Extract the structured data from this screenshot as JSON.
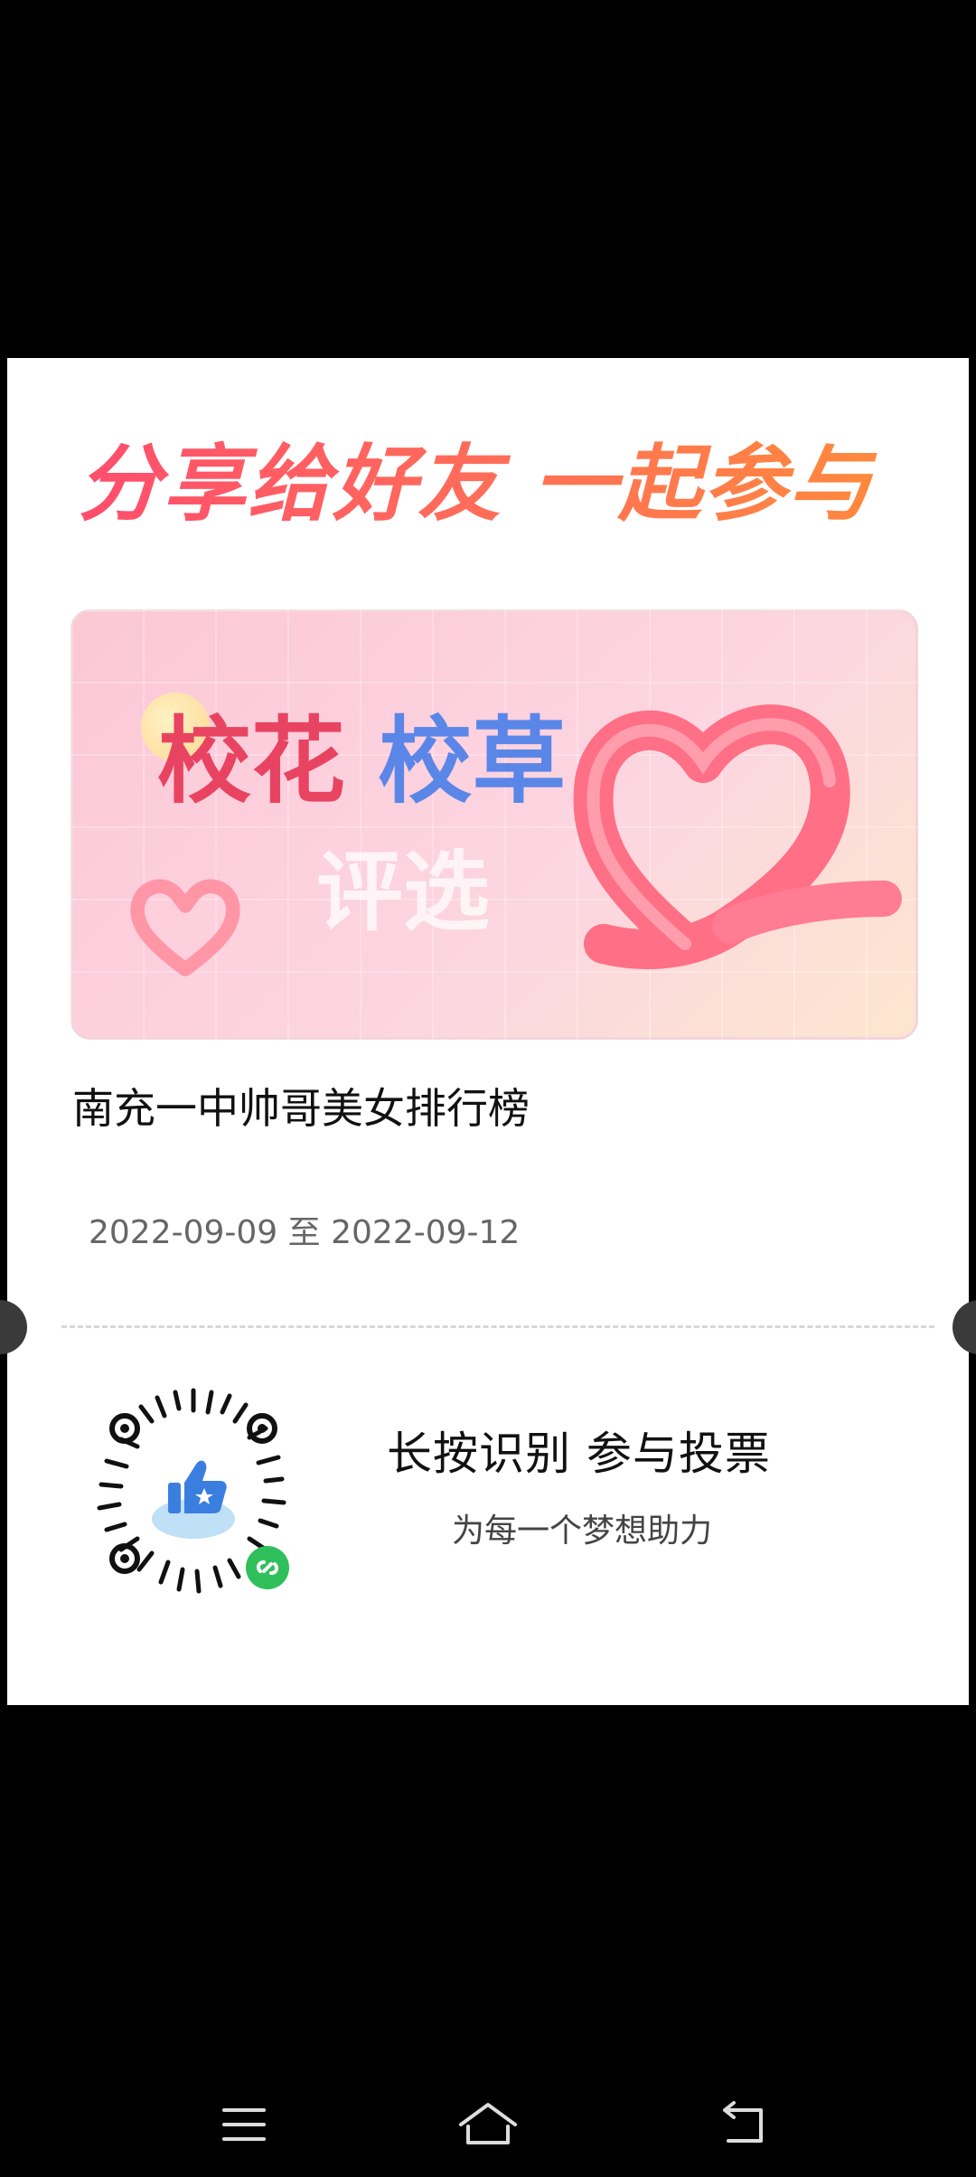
{
  "share": {
    "title": "分享给好友 一起参与"
  },
  "banner": {
    "title_a": "校花",
    "title_b": "校草",
    "subtitle": "评选",
    "colors": {
      "pink_text": "#e84461",
      "blue_text": "#5a86e8",
      "heart": "#ff6f86"
    }
  },
  "event": {
    "name": "南充一中帅哥美女排行榜",
    "date_range": "2022-09-09 至 2022-09-12"
  },
  "cta": {
    "title": "长按识别  参与投票",
    "subtitle": "为每一个梦想助力"
  },
  "icons": {
    "qr": "mini-program-qr-icon",
    "thumb": "thumbs-up-icon",
    "menu": "menu-icon",
    "home": "home-icon",
    "back": "back-icon"
  }
}
